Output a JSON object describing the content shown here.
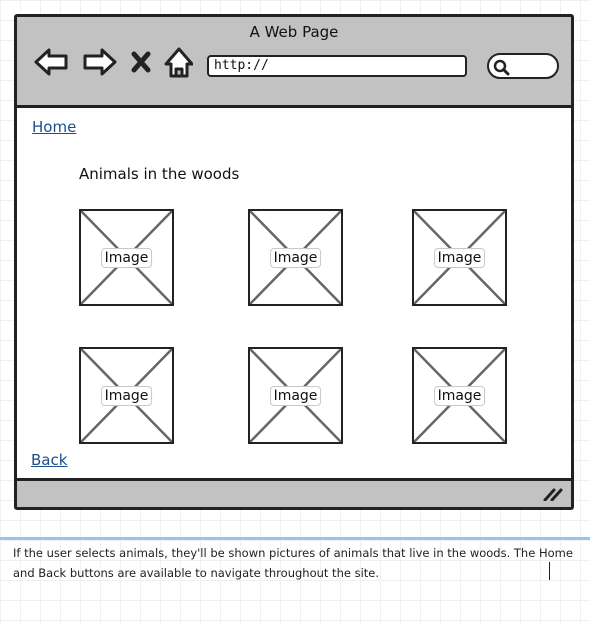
{
  "window": {
    "title": "A Web Page",
    "url": "http://"
  },
  "icons": {
    "back": "arrow-left-icon",
    "forward": "arrow-right-icon",
    "stop": "close-icon",
    "home": "home-icon",
    "search": "search-icon",
    "resize": "resize-grip-icon"
  },
  "page": {
    "home_link": "Home",
    "heading": "Animals in the woods",
    "images": [
      {
        "label": "Image"
      },
      {
        "label": "Image"
      },
      {
        "label": "Image"
      },
      {
        "label": "Image"
      },
      {
        "label": "Image"
      },
      {
        "label": "Image"
      }
    ],
    "back_link": "Back"
  },
  "annotation": "If the user selects animals, they'll be shown pictures of animals that live in the woods. The Home and Back buttons are available to navigate throughout the site.",
  "colors": {
    "chrome": "#c2c2c2",
    "link": "#1a4f8c",
    "annotation_rule": "#9cc2e8"
  }
}
